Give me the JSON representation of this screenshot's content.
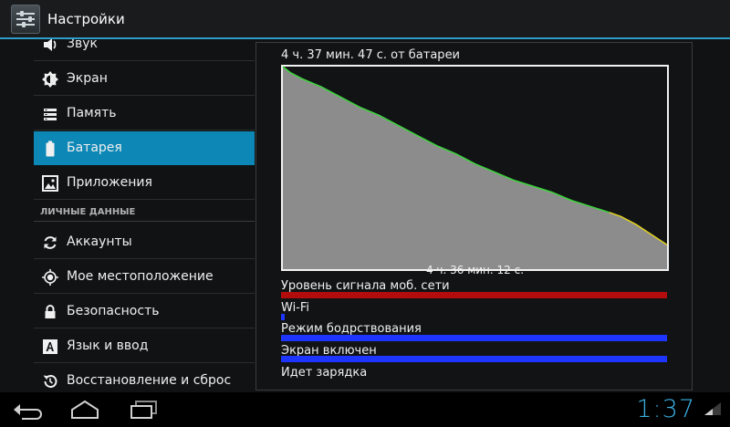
{
  "app": {
    "title": "Настройки"
  },
  "menu": {
    "items_top": [
      {
        "label": "Звук",
        "icon": "speaker-icon"
      },
      {
        "label": "Экран",
        "icon": "brightness-icon"
      },
      {
        "label": "Память",
        "icon": "storage-icon"
      },
      {
        "label": "Батарея",
        "icon": "battery-icon",
        "selected": true
      },
      {
        "label": "Приложения",
        "icon": "apps-icon"
      }
    ],
    "section_personal": "ЛИЧНЫЕ ДАННЫЕ",
    "items_personal": [
      {
        "label": "Аккаунты",
        "icon": "sync-icon"
      },
      {
        "label": "Мое местоположение",
        "icon": "location-icon"
      },
      {
        "label": "Безопасность",
        "icon": "lock-icon"
      },
      {
        "label": "Язык и ввод",
        "icon": "language-icon"
      },
      {
        "label": "Восстановление и сброс",
        "icon": "restore-icon"
      }
    ]
  },
  "battery": {
    "title": "4 ч. 37 мин. 47 с. от батареи",
    "duration": "4 ч. 36 мин. 12 с.",
    "signal_label": "Уровень сигнала моб. сети",
    "wifi_label": "Wi-Fi",
    "awake_label": "Режим бодрствования",
    "screen_label": "Экран включен",
    "charging_label": "Идет зарядка",
    "colors": {
      "signal": "#b30c0c",
      "wifi": "#1e35ff",
      "awake": "#1e35ff",
      "screen": "#1e35ff",
      "line_good": "#3bd63b",
      "line_mid": "#e0d020",
      "fill": "#8c8c8c"
    },
    "state_bars": {
      "signal": 1.0,
      "wifi": 0.01,
      "awake": 1.0,
      "screen": 1.0
    }
  },
  "chart_data": {
    "type": "area",
    "title": "4 ч. 37 мин. 47 с. от батареи",
    "xlabel": "4 ч. 36 мин. 12 с.",
    "ylabel": "",
    "ylim": [
      0,
      100
    ],
    "x_unit": "time fraction",
    "series": [
      {
        "x": [
          0,
          0.02,
          0.05,
          0.1,
          0.15,
          0.2,
          0.25,
          0.3,
          0.35,
          0.4,
          0.45,
          0.5,
          0.55,
          0.6,
          0.65,
          0.7,
          0.75,
          0.8,
          0.85,
          0.88,
          0.92,
          0.96,
          1.0
        ],
        "values": [
          100,
          97,
          94,
          90,
          85,
          80,
          76,
          71,
          66,
          61,
          57,
          52,
          48,
          44,
          41,
          38,
          34,
          31,
          28,
          26,
          22,
          17,
          12
        ]
      }
    ],
    "grid": false
  },
  "nav": {
    "time": "1:37"
  }
}
